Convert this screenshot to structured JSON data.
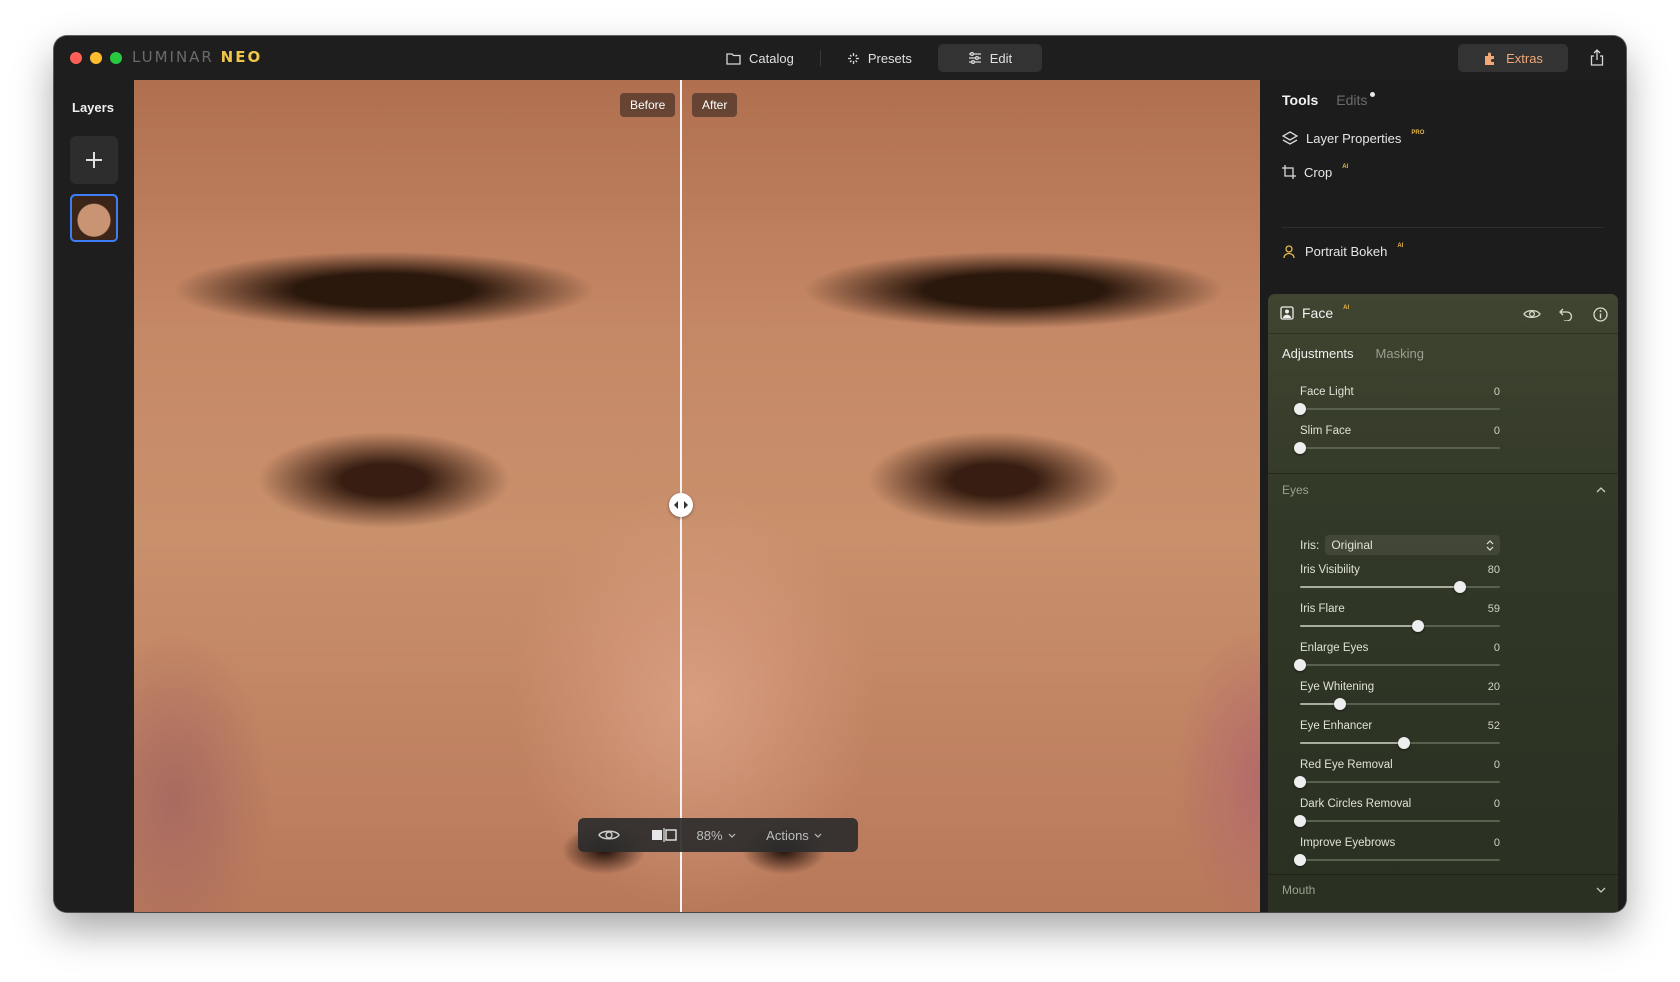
{
  "app": {
    "brand_main": "LUMINAR",
    "brand_accent": "NEO"
  },
  "topnav": {
    "catalog": "Catalog",
    "presets": "Presets",
    "edit": "Edit",
    "extras": "Extras"
  },
  "layers": {
    "title": "Layers"
  },
  "canvas": {
    "before_label": "Before",
    "after_label": "After"
  },
  "bottombar": {
    "zoom": "88%",
    "actions": "Actions"
  },
  "panel": {
    "tabs": {
      "tools": "Tools",
      "edits": "Edits"
    },
    "tools": [
      {
        "label": "Layer Properties",
        "badge": "PRO",
        "icon": "layers-icon"
      },
      {
        "label": "Crop",
        "badge": "AI",
        "icon": "crop-icon"
      },
      {
        "label": "Portrait Bokeh",
        "badge": "AI",
        "icon": "portrait-icon"
      }
    ],
    "face": {
      "title": "Face",
      "badge": "AI",
      "subtabs": {
        "adjustments": "Adjustments",
        "masking": "Masking"
      },
      "face_sliders": [
        {
          "label": "Face Light",
          "value": 0
        },
        {
          "label": "Slim Face",
          "value": 0
        }
      ],
      "eyes": {
        "title": "Eyes",
        "iris_label": "Iris:",
        "iris_value": "Original",
        "sliders": [
          {
            "label": "Iris Visibility",
            "value": 80
          },
          {
            "label": "Iris Flare",
            "value": 59
          },
          {
            "label": "Enlarge Eyes",
            "value": 0
          },
          {
            "label": "Eye Whitening",
            "value": 20
          },
          {
            "label": "Eye Enhancer",
            "value": 52
          },
          {
            "label": "Red Eye Removal",
            "value": 0
          },
          {
            "label": "Dark Circles Removal",
            "value": 0
          },
          {
            "label": "Improve Eyebrows",
            "value": 0
          }
        ]
      },
      "mouth": {
        "title": "Mouth"
      }
    }
  },
  "colors": {
    "accent_blue": "#3d7ef5",
    "extras_orange": "#f0a878",
    "badge_gold": "#e6b84a"
  }
}
